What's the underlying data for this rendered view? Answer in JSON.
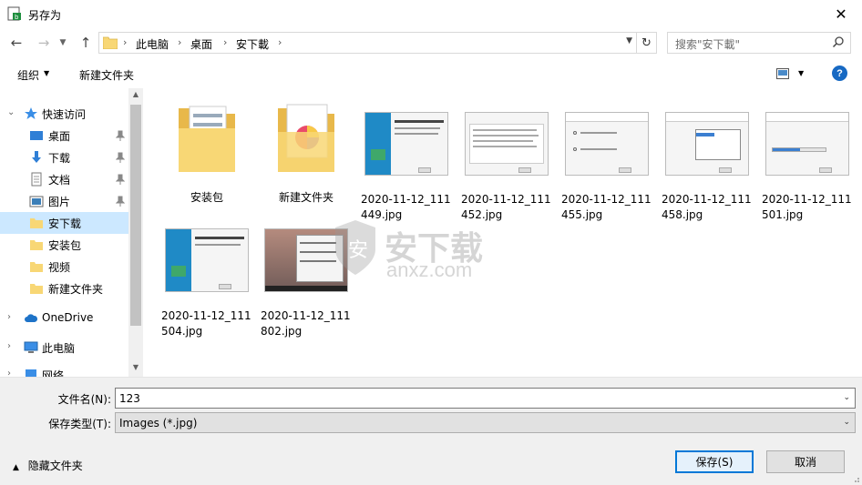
{
  "window": {
    "title": "另存为"
  },
  "nav": {
    "breadcrumb": [
      "此电脑",
      "桌面",
      "安下載"
    ],
    "search_placeholder": "搜索\"安下載\""
  },
  "toolbar": {
    "organize": "组织",
    "new_folder": "新建文件夹"
  },
  "sidebar": {
    "items": [
      {
        "label": "快速访问",
        "icon": "star-icon"
      },
      {
        "label": "桌面",
        "icon": "desktop-icon",
        "pinned": true
      },
      {
        "label": "下载",
        "icon": "download-icon",
        "pinned": true
      },
      {
        "label": "文档",
        "icon": "document-icon",
        "pinned": true
      },
      {
        "label": "图片",
        "icon": "picture-icon",
        "pinned": true
      },
      {
        "label": "安下载",
        "icon": "folder-icon",
        "selected": true
      },
      {
        "label": "安装包",
        "icon": "folder-icon"
      },
      {
        "label": "视频",
        "icon": "folder-icon"
      },
      {
        "label": "新建文件夹",
        "icon": "folder-icon"
      },
      {
        "label": "OneDrive",
        "icon": "cloud-icon"
      },
      {
        "label": "此电脑",
        "icon": "computer-icon"
      },
      {
        "label": "网络",
        "icon": "network-icon"
      }
    ]
  },
  "files": [
    {
      "name": "安装包",
      "type": "folder"
    },
    {
      "name": "新建文件夹",
      "type": "folder-image"
    },
    {
      "name": "2020-11-12_111449.jpg",
      "type": "image"
    },
    {
      "name": "2020-11-12_111452.jpg",
      "type": "image"
    },
    {
      "name": "2020-11-12_111455.jpg",
      "type": "image"
    },
    {
      "name": "2020-11-12_111458.jpg",
      "type": "image"
    },
    {
      "name": "2020-11-12_111501.jpg",
      "type": "image"
    },
    {
      "name": "2020-11-12_111504.jpg",
      "type": "image"
    },
    {
      "name": "2020-11-12_111802.jpg",
      "type": "image"
    }
  ],
  "watermark": {
    "text": "安下载",
    "sub": "anxz.com"
  },
  "form": {
    "filename_label": "文件名(N):",
    "filename_value": "123",
    "filetype_label": "保存类型(T):",
    "filetype_value": "Images (*.jpg)",
    "hide_folders": "隐藏文件夹",
    "save": "保存(S)",
    "cancel": "取消"
  },
  "colors": {
    "selected": "#cce8ff",
    "accent": "#0078d7",
    "folder": "#f8d775"
  }
}
